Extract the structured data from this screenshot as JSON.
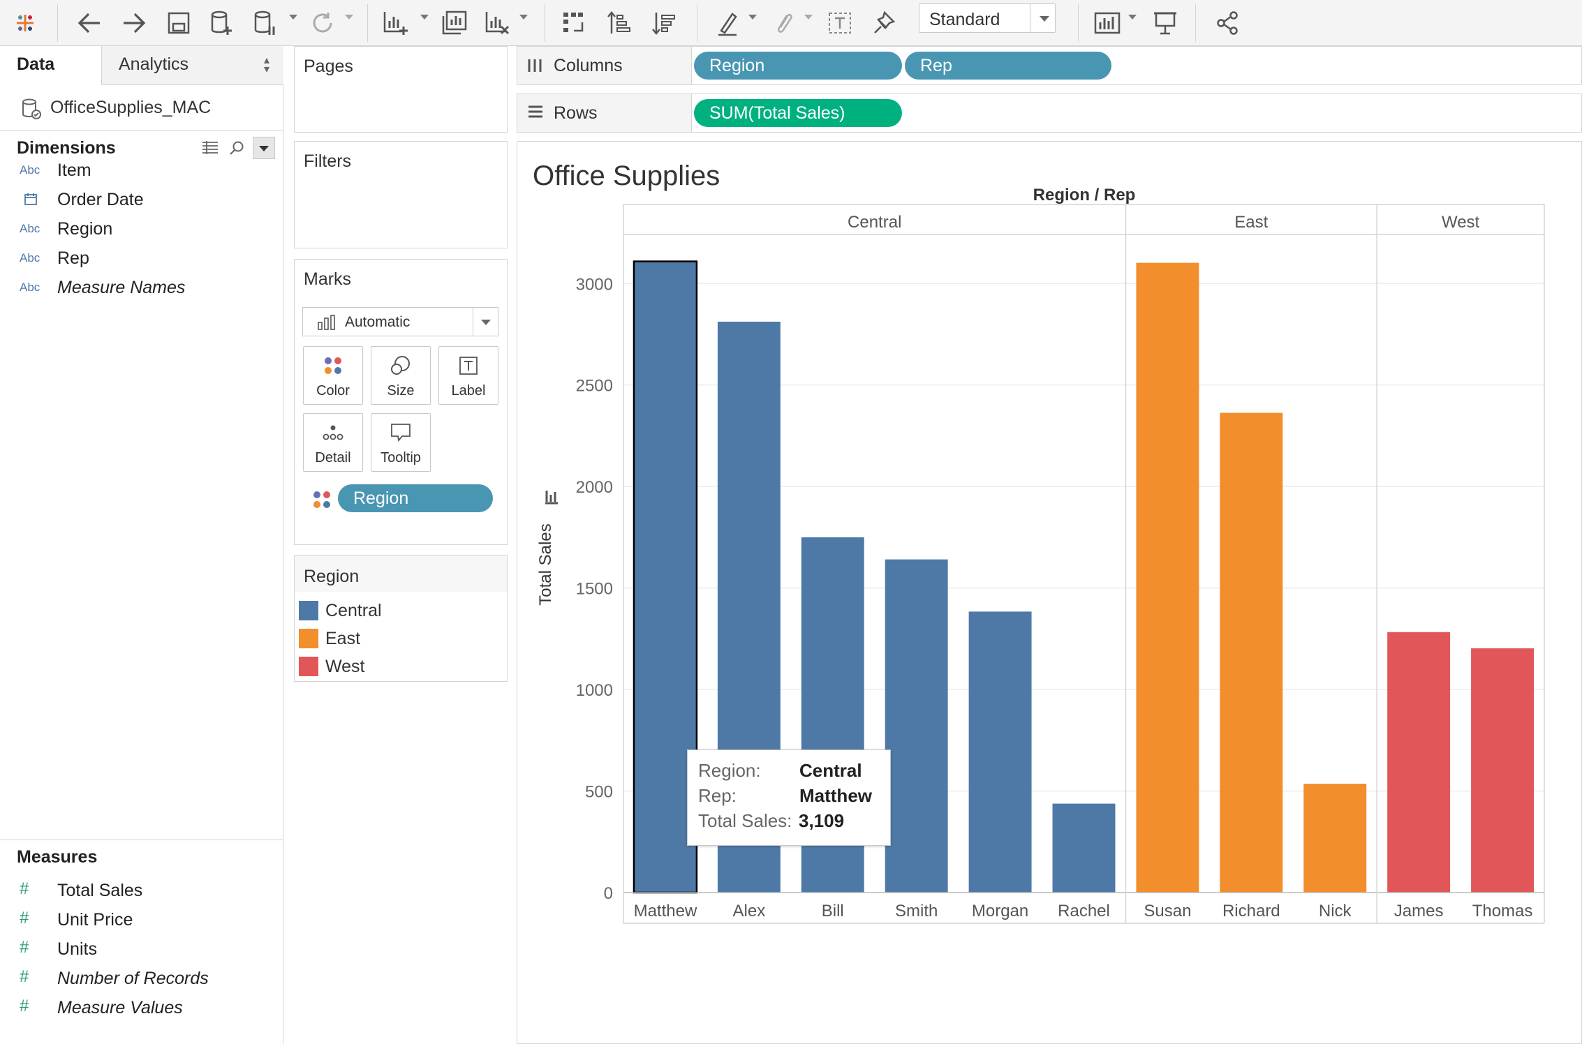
{
  "toolbar": {
    "fit_select": "Standard",
    "icons": [
      "tableau-logo-icon",
      "back-icon",
      "forward-icon",
      "save-icon",
      "new-data-source-icon",
      "pause-updates-icon",
      "refresh-icon",
      "new-worksheet-icon",
      "duplicate-sheet-icon",
      "clear-sheet-icon",
      "swap-icon",
      "sort-ascending-icon",
      "sort-descending-icon",
      "highlight-icon",
      "group-icon",
      "show-labels-icon",
      "pin-icon",
      "show-me-icon",
      "presentation-icon",
      "share-icon"
    ]
  },
  "data_pane": {
    "tab_data": "Data",
    "tab_analytics": "Analytics",
    "datasource": "OfficeSupplies_MAC",
    "dimensions_title": "Dimensions",
    "dimensions": [
      {
        "type": "Abc",
        "name": "Item",
        "italic": false
      },
      {
        "type": "date",
        "name": "Order Date",
        "italic": false
      },
      {
        "type": "Abc",
        "name": "Region",
        "italic": false
      },
      {
        "type": "Abc",
        "name": "Rep",
        "italic": false
      },
      {
        "type": "Abc",
        "name": "Measure Names",
        "italic": true
      }
    ],
    "measures_title": "Measures",
    "measures": [
      {
        "name": "Total Sales",
        "italic": false
      },
      {
        "name": "Unit Price",
        "italic": false
      },
      {
        "name": "Units",
        "italic": false
      },
      {
        "name": "Number of Records",
        "italic": true
      },
      {
        "name": "Measure Values",
        "italic": true
      }
    ]
  },
  "cards": {
    "pages": "Pages",
    "filters": "Filters",
    "marks": "Marks",
    "marks_type": "Automatic",
    "mark_buttons": [
      "Color",
      "Size",
      "Label",
      "Detail",
      "Tooltip"
    ],
    "marks_pill": "Region",
    "legend_title": "Region",
    "legend": [
      {
        "name": "Central",
        "color": "#4e79a7"
      },
      {
        "name": "East",
        "color": "#f28e2b"
      },
      {
        "name": "West",
        "color": "#e15759"
      }
    ]
  },
  "shelves": {
    "columns_label": "Columns",
    "columns_pills": [
      "Region",
      "Rep"
    ],
    "rows_label": "Rows",
    "rows_pills": [
      "SUM(Total Sales)"
    ]
  },
  "tooltip": {
    "rows": [
      {
        "key": "Region:",
        "value": "Central"
      },
      {
        "key": "Rep:",
        "value": "Matthew"
      },
      {
        "key": "Total Sales:",
        "value": "3,109"
      }
    ]
  },
  "chart_data": {
    "type": "bar",
    "title": "Office Supplies",
    "header": "Region / Rep",
    "ylabel": "Total Sales",
    "ylim": [
      0,
      3300
    ],
    "yticks": [
      0,
      500,
      1000,
      1500,
      2000,
      2500,
      3000
    ],
    "groups": [
      {
        "name": "Central",
        "color": "#4e79a7",
        "reps": [
          "Matthew",
          "Alex",
          "Bill",
          "Smith",
          "Morgan",
          "Rachel"
        ],
        "values": [
          3109,
          2812,
          1750,
          1641,
          1384,
          438
        ]
      },
      {
        "name": "East",
        "color": "#f28e2b",
        "reps": [
          "Susan",
          "Richard",
          "Nick"
        ],
        "values": [
          3102,
          2363,
          536
        ]
      },
      {
        "name": "West",
        "color": "#e15759",
        "reps": [
          "James",
          "Thomas"
        ],
        "values": [
          1283,
          1203
        ]
      }
    ],
    "selected": {
      "group": "Central",
      "rep": "Matthew"
    }
  }
}
